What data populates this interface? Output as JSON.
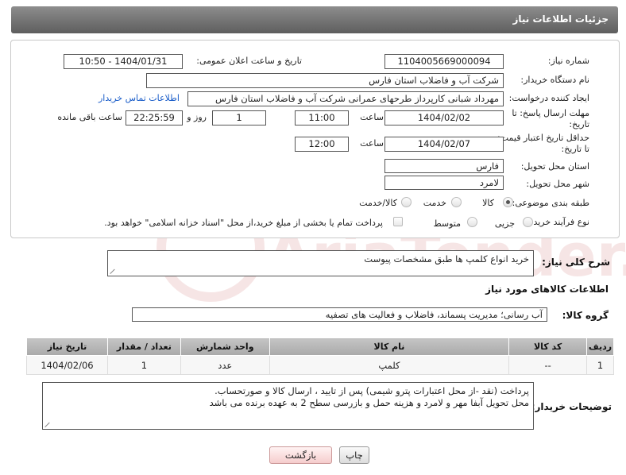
{
  "header": {
    "title": "جزئیات اطلاعات نیاز"
  },
  "fields": {
    "need_number_label": "شماره نیاز:",
    "need_number": "1104005669000094",
    "announce_label": "تاریخ و ساعت اعلان عمومی:",
    "announce_value": "1404/01/31 - 10:50",
    "buyer_org_label": "نام دستگاه خریدار:",
    "buyer_org": "شرکت آب و فاضلاب استان فارس",
    "creator_label": "ایجاد کننده درخواست:",
    "creator": "مهرداد شبانی کارپرداز طرحهای عمرانی  شرکت آب و فاضلاب استان فارس",
    "contact_link": "اطلاعات تماس خریدار",
    "reply_deadline_label_1": "مهلت ارسال پاسخ: تا",
    "reply_deadline_label_2": "تاریخ:",
    "reply_date": "1404/02/02",
    "time_label": "ساعت",
    "reply_time": "11:00",
    "days_value": "1",
    "days_label": "روز و",
    "remaining_time": "22:25:59",
    "remaining_label": "ساعت باقی مانده",
    "price_deadline_label_1": "حداقل تاریخ اعتبار قیمت:",
    "price_deadline_label_2": "تا تاریخ:",
    "price_date": "1404/02/07",
    "price_time": "12:00",
    "province_label": "استان محل تحویل:",
    "province": "فارس",
    "city_label": "شهر محل تحویل:",
    "city": "لامرد",
    "category_label": "طبقه بندی موضوعی:",
    "category_options": [
      "کالا",
      "خدمت",
      "کالا/خدمت"
    ],
    "category_selected": "کالا",
    "process_label": "نوع فرآیند خرید :",
    "process_options": [
      "جزیی",
      "متوسط"
    ],
    "payment_note": "پرداخت تمام یا بخشی از مبلغ خرید،از محل \"اسناد خزانه اسلامی\" خواهد بود."
  },
  "description": {
    "label": "شرح کلی نیاز:",
    "value": "خرید انواع کلمپ ها طبق مشخصات پیوست"
  },
  "goods_section": {
    "title": "اطلاعات کالاهای مورد نیاز",
    "group_label": "گروه کالا:",
    "group_value": "آب رسانی؛ مدیریت پسماند، فاضلاب و فعالیت های تصفیه"
  },
  "table": {
    "headers": [
      "ردیف",
      "کد کالا",
      "نام کالا",
      "واحد شمارش",
      "تعداد / مقدار",
      "تاریخ نیاز"
    ],
    "rows": [
      [
        "1",
        "--",
        "کلمپ",
        "عدد",
        "1",
        "1404/02/06"
      ]
    ]
  },
  "buyer_notes": {
    "label": "توضیحات خریدار:",
    "line1": "پرداخت  (نقد -از محل اعتبارات پترو شیمی) پس از تایید ، ارسال کالا  و صورتحساب.",
    "line2": "محل تحویل  آبفا مهر و لامرد  و هزینه حمل و بازرسی سطح 2 به عهده برنده می باشد"
  },
  "buttons": {
    "print": "چاپ",
    "back": "بازگشت"
  },
  "watermark": {
    "text": "AriaTender.net"
  },
  "colors": {
    "header_bg": "#6e6e6e",
    "link": "#1a5dc9",
    "back_button": "#f5cccc"
  }
}
